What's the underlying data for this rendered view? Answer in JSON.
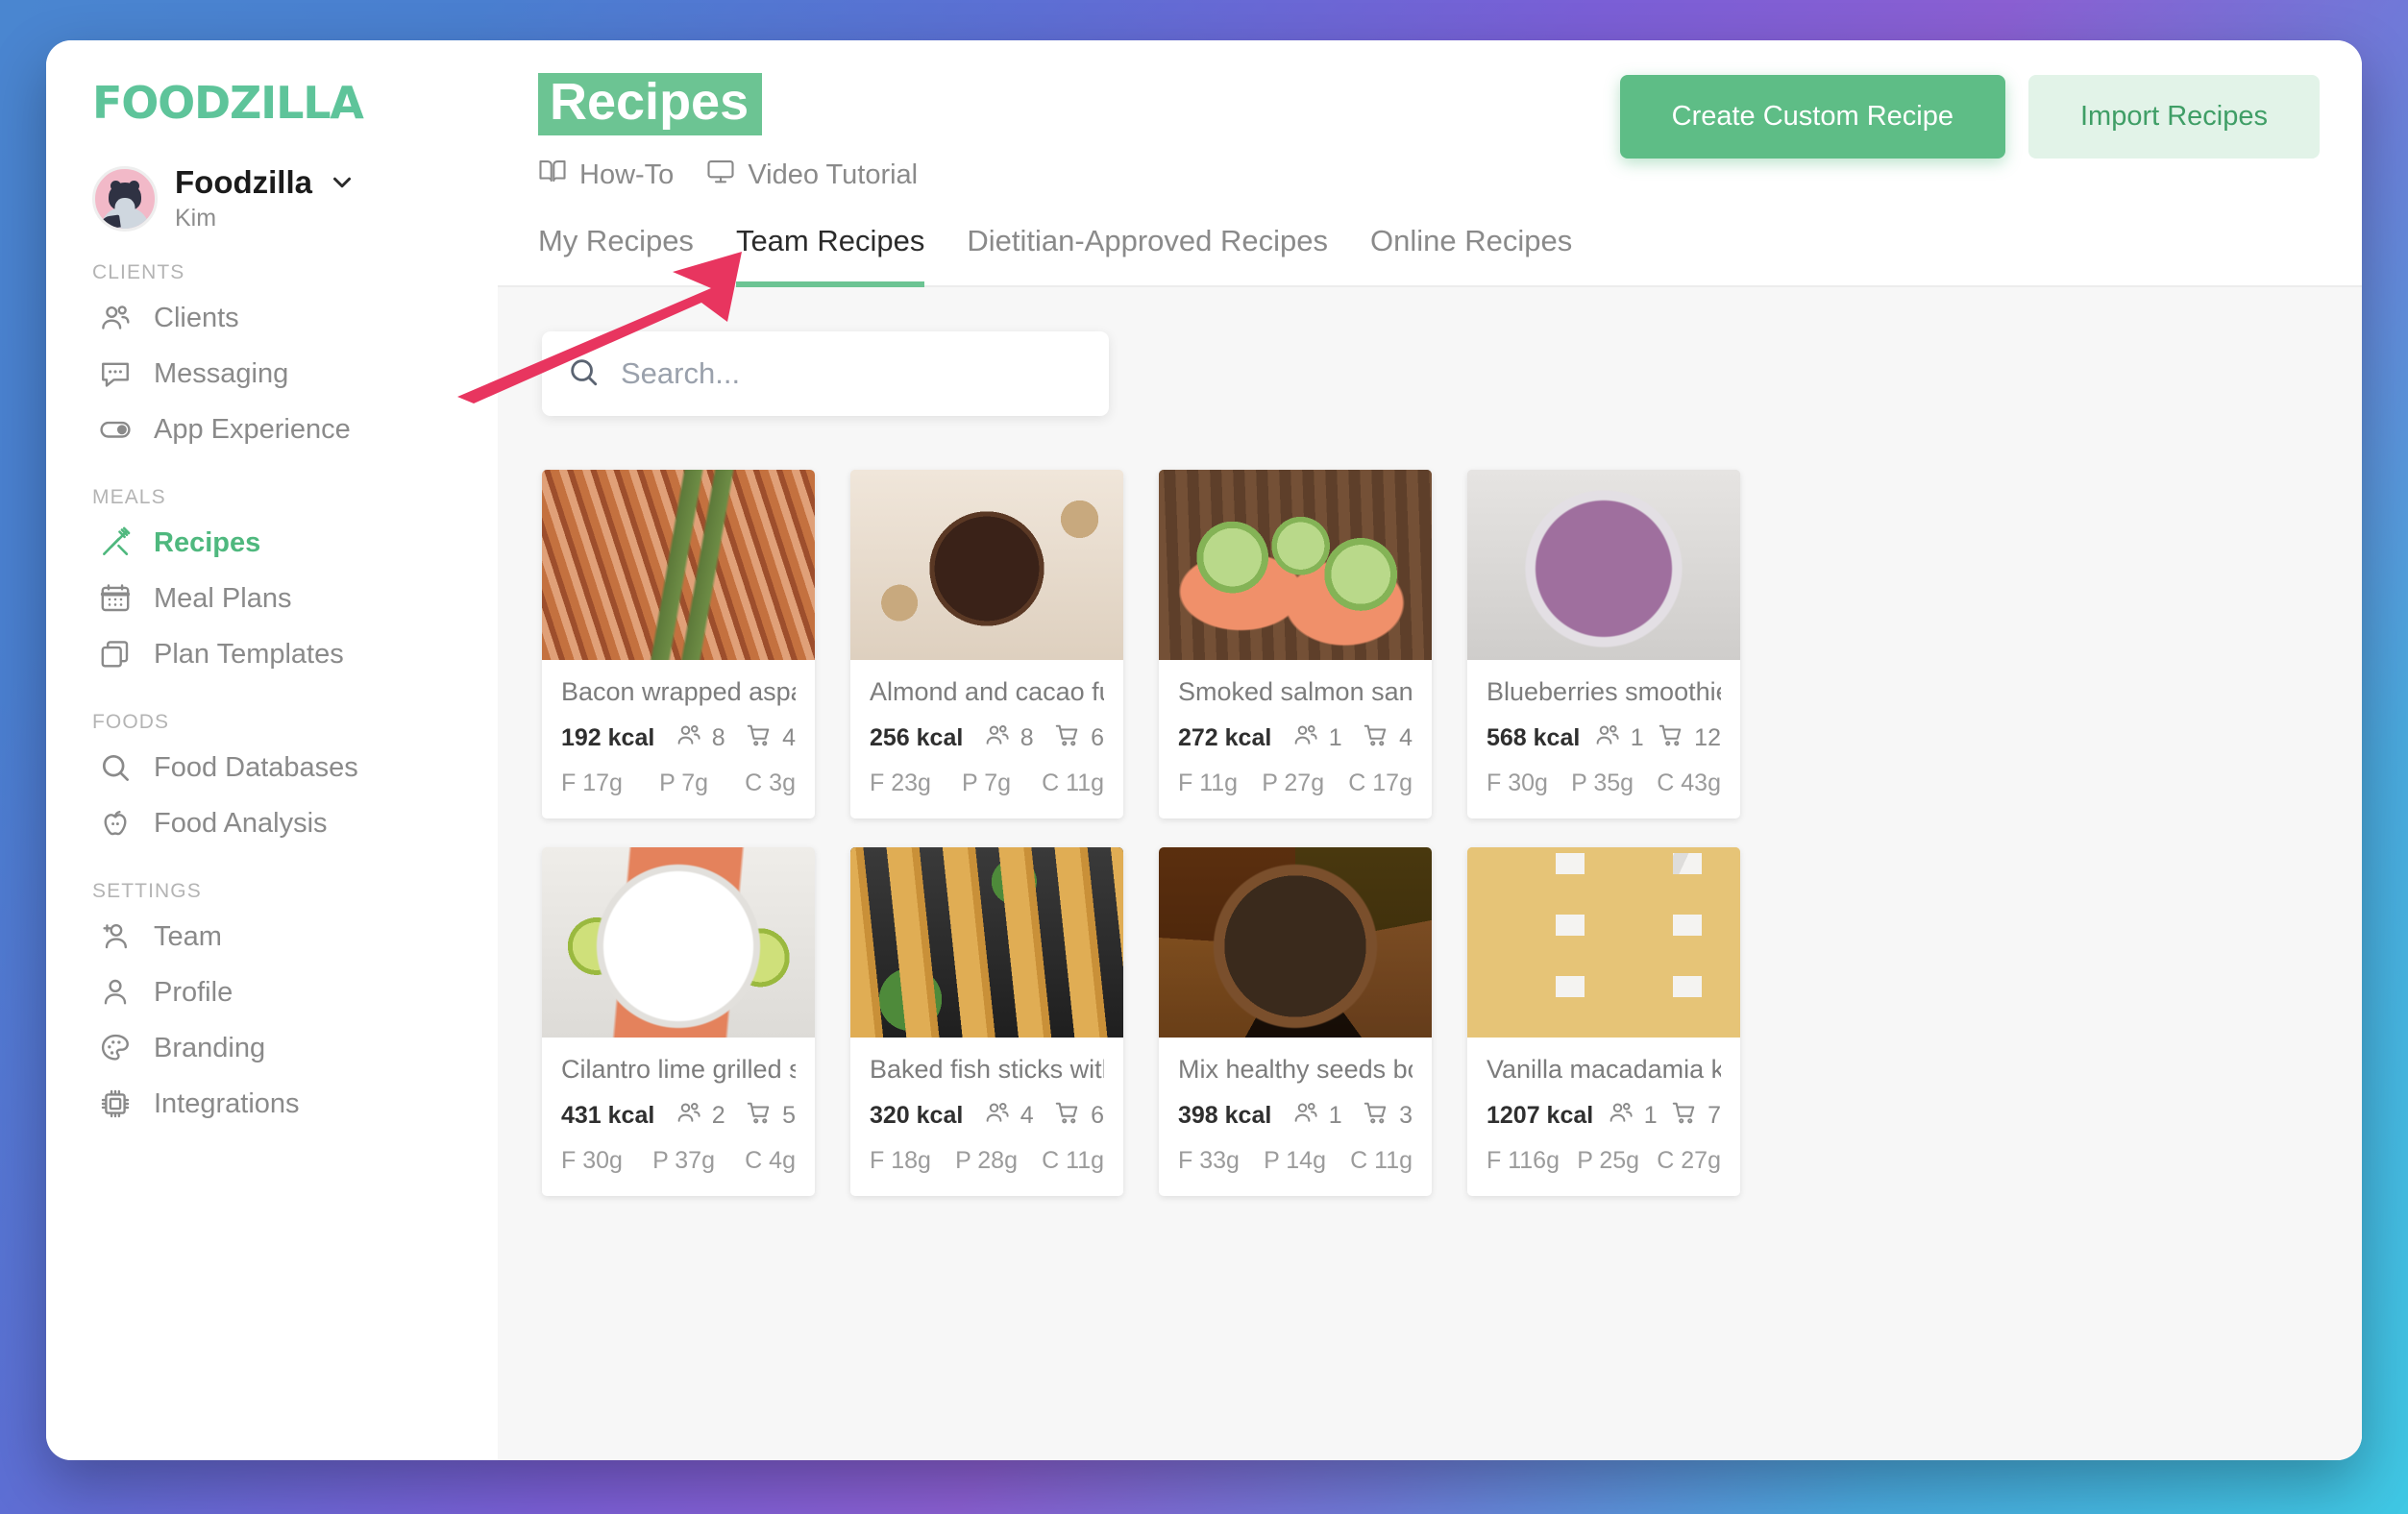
{
  "brand": {
    "logo_text": "FOODZILLA",
    "logo_color": "#5ec49a"
  },
  "profile": {
    "name": "Foodzilla",
    "sub": "Kim",
    "chevron_icon": "chevron-down-icon"
  },
  "sidebar": {
    "groups": [
      {
        "title": "CLIENTS",
        "items": [
          {
            "label": "Clients",
            "icon": "users-icon",
            "active": false
          },
          {
            "label": "Messaging",
            "icon": "chat-bubble-icon",
            "active": false
          },
          {
            "label": "App Experience",
            "icon": "toggle-switch-icon",
            "active": false
          }
        ]
      },
      {
        "title": "MEALS",
        "items": [
          {
            "label": "Recipes",
            "icon": "fork-knife-icon",
            "active": true
          },
          {
            "label": "Meal Plans",
            "icon": "calendar-icon",
            "active": false
          },
          {
            "label": "Plan Templates",
            "icon": "copy-icon",
            "active": false
          }
        ]
      },
      {
        "title": "FOODS",
        "items": [
          {
            "label": "Food Databases",
            "icon": "search-icon",
            "active": false
          },
          {
            "label": "Food Analysis",
            "icon": "apple-icon",
            "active": false
          }
        ]
      },
      {
        "title": "SETTINGS",
        "items": [
          {
            "label": "Team",
            "icon": "user-plus-icon",
            "active": false
          },
          {
            "label": "Profile",
            "icon": "user-icon",
            "active": false
          },
          {
            "label": "Branding",
            "icon": "palette-icon",
            "active": false
          },
          {
            "label": "Integrations",
            "icon": "chip-icon",
            "active": false
          }
        ]
      }
    ]
  },
  "header": {
    "title": "Recipes",
    "title_highlight_color": "#6cc493",
    "help_links": [
      {
        "label": "How-To",
        "icon": "book-icon"
      },
      {
        "label": "Video Tutorial",
        "icon": "monitor-icon"
      }
    ],
    "primary_button": "Create Custom Recipe",
    "secondary_button": "Import Recipes"
  },
  "tabs": [
    {
      "label": "My Recipes",
      "active": false
    },
    {
      "label": "Team Recipes",
      "active": true
    },
    {
      "label": "Dietitian-Approved Recipes",
      "active": false
    },
    {
      "label": "Online Recipes",
      "active": false
    }
  ],
  "search": {
    "placeholder": "Search...",
    "value": "",
    "icon": "search-icon"
  },
  "annotation": {
    "type": "arrow",
    "color": "#e8355f",
    "points_to": "Team Recipes"
  },
  "recipes": [
    {
      "title": "Bacon wrapped asparagus",
      "kcal": "192 kcal",
      "servings": "8",
      "ingredients": "4",
      "fat": "F 17g",
      "protein": "P 7g",
      "carbs": "C 3g",
      "image": "bacon-wrapped-asparagus"
    },
    {
      "title": "Almond and cacao fudge",
      "kcal": "256 kcal",
      "servings": "8",
      "ingredients": "6",
      "fat": "F 23g",
      "protein": "P 7g",
      "carbs": "C 11g",
      "image": "almond-cacao-fudge"
    },
    {
      "title": "Smoked salmon sandwic…",
      "kcal": "272 kcal",
      "servings": "1",
      "ingredients": "4",
      "fat": "F 11g",
      "protein": "P 27g",
      "carbs": "C 17g",
      "image": "smoked-salmon-sandwich"
    },
    {
      "title": "Blueberries smoothies p…",
      "kcal": "568 kcal",
      "servings": "1",
      "ingredients": "12",
      "fat": "F 30g",
      "protein": "P 35g",
      "carbs": "C 43g",
      "image": "blueberries-smoothie"
    },
    {
      "title": "Cilantro lime grilled sal…",
      "kcal": "431 kcal",
      "servings": "2",
      "ingredients": "5",
      "fat": "F 30g",
      "protein": "P 37g",
      "carbs": "C 4g",
      "image": "cilantro-lime-salmon"
    },
    {
      "title": "Baked fish sticks with pa…",
      "kcal": "320 kcal",
      "servings": "4",
      "ingredients": "6",
      "fat": "F 18g",
      "protein": "P 28g",
      "carbs": "C 11g",
      "image": "baked-fish-sticks"
    },
    {
      "title": "Mix healthy seeds bowl …",
      "kcal": "398 kcal",
      "servings": "1",
      "ingredients": "3",
      "fat": "F 33g",
      "protein": "P 14g",
      "carbs": "C 11g",
      "image": "mixed-seeds-bowl"
    },
    {
      "title": "Vanilla macadamia keto …",
      "kcal": "1207 kcal",
      "servings": "1",
      "ingredients": "7",
      "fat": "F 116g",
      "protein": "P 25g",
      "carbs": "C 27g",
      "image": "vanilla-macadamia-bars"
    }
  ]
}
